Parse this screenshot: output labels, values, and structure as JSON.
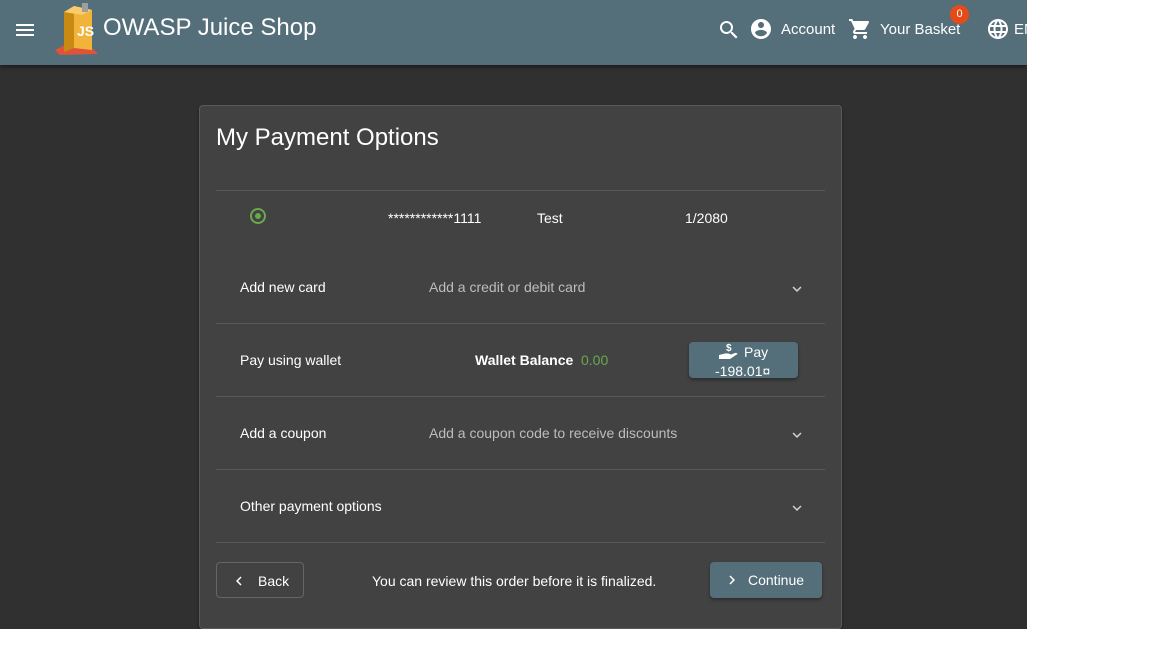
{
  "header": {
    "menu_icon": "menu-icon",
    "logo_icon": "juice-shop-logo",
    "title": "OWASP Juice Shop",
    "search_icon": "search-icon",
    "account_label": "Account",
    "basket_label": "Your Basket",
    "basket_count": "0",
    "language_label": "EN"
  },
  "payment": {
    "heading": "My Payment Options",
    "saved_card": {
      "number": "************1111",
      "holder": "Test",
      "expiry": "1/2080",
      "selected": true
    },
    "add_card": {
      "title": "Add new card",
      "description": "Add a credit or debit card"
    },
    "wallet": {
      "title": "Pay using wallet",
      "balance_label": "Wallet Balance",
      "balance_value": "0.00",
      "pay_label": "Pay",
      "pay_amount": "-198.01¤"
    },
    "coupon": {
      "title": "Add a coupon",
      "description": "Add a coupon code to receive discounts"
    },
    "other": {
      "title": "Other payment options"
    },
    "footer": {
      "back_label": "Back",
      "note": "You can review this order before it is finalized.",
      "continue_label": "Continue"
    }
  },
  "colors": {
    "toolbar": "#546e7a",
    "background": "#303030",
    "card": "#424242",
    "accent_green": "#69a84f",
    "badge": "#e64a19"
  }
}
